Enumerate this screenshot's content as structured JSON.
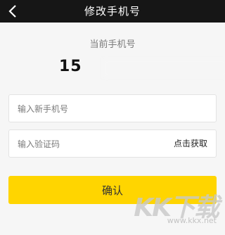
{
  "header": {
    "title": "修改手机号",
    "back_icon": "chevron-left-icon"
  },
  "current": {
    "label": "当前手机号",
    "phone_visible": "15"
  },
  "form": {
    "new_phone_placeholder": "输入新手机号",
    "new_phone_value": "",
    "code_placeholder": "输入验证码",
    "code_value": "",
    "get_code_label": "点击获取",
    "confirm_label": "确认"
  },
  "watermark": {
    "logo": "KK下载",
    "url": "www.kkx.net"
  },
  "colors": {
    "header_bg": "#161616",
    "accent": "#ffd500",
    "page_bg": "#f6f6f6"
  }
}
